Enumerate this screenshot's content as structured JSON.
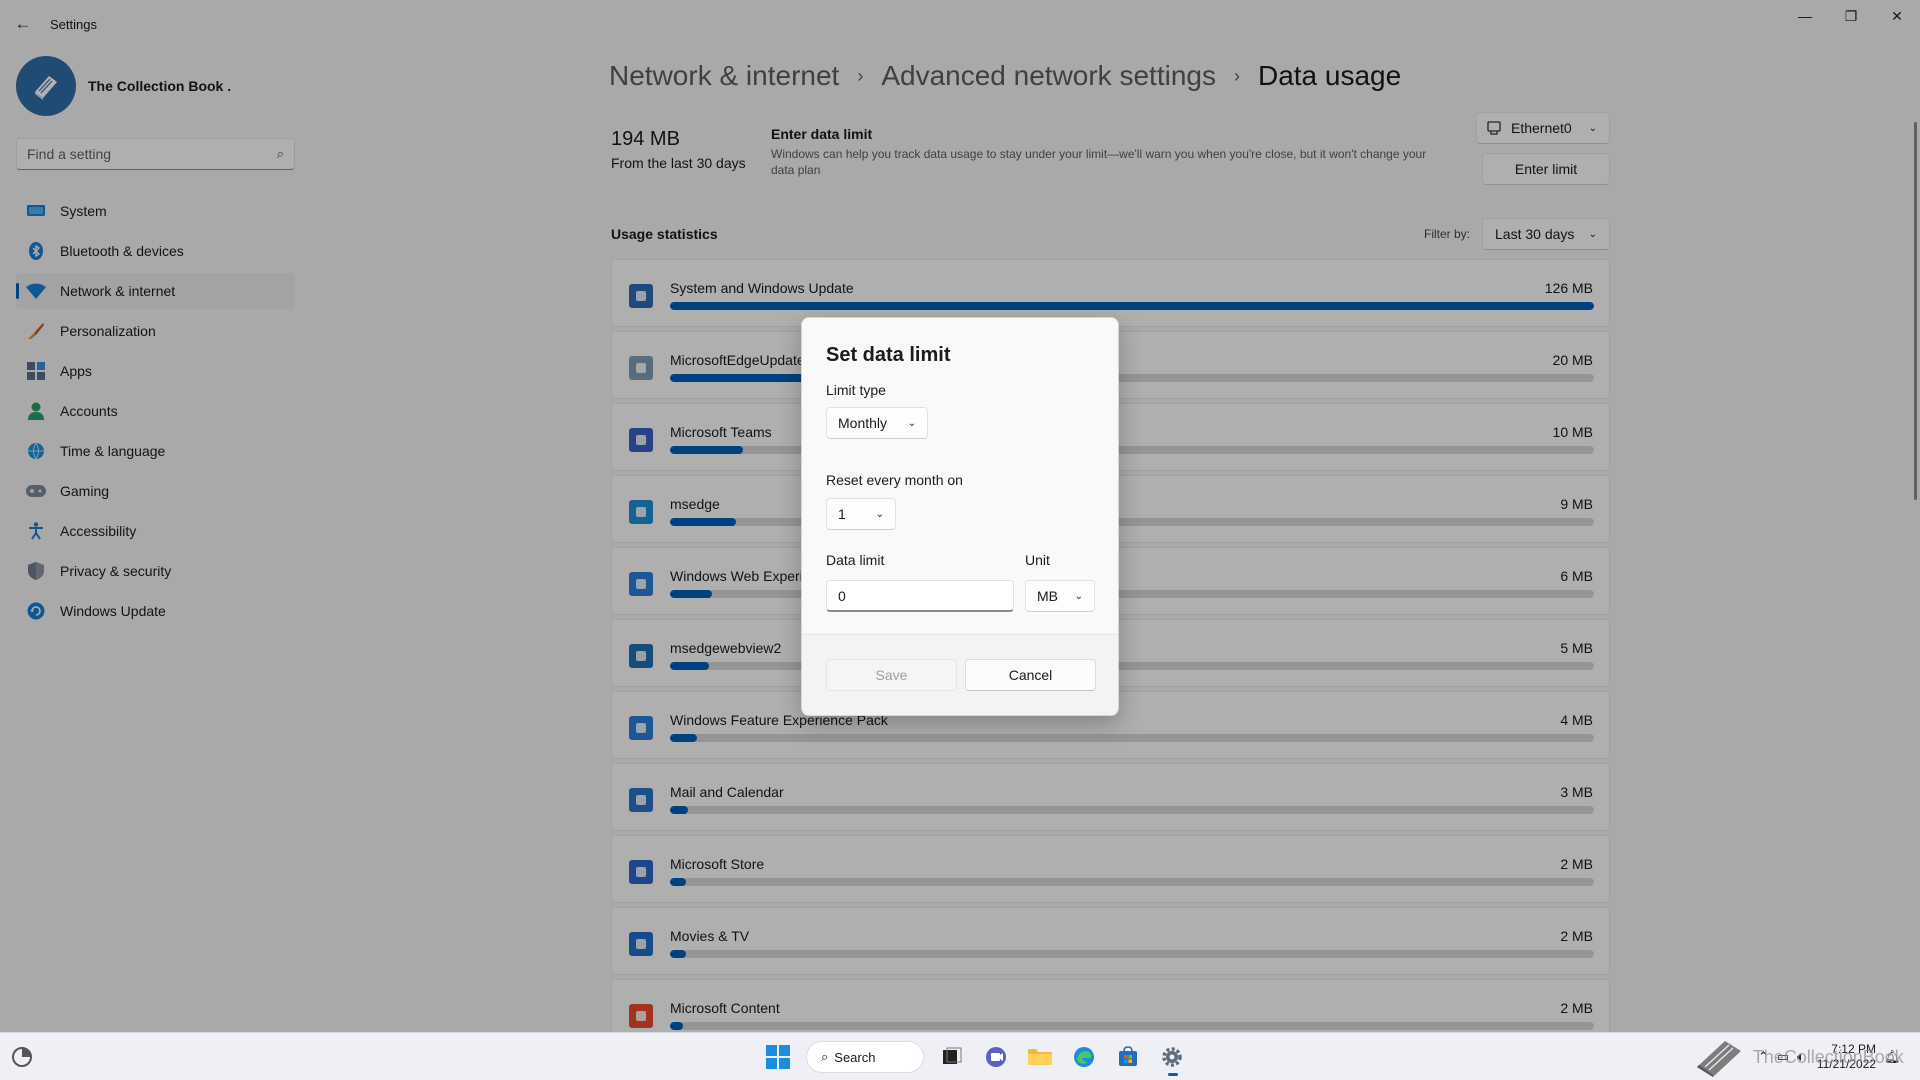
{
  "window": {
    "title": "Settings",
    "back_label": "←",
    "minimize": "—",
    "maximize": "❐",
    "close": "✕"
  },
  "profile": {
    "name": "The Collection Book ."
  },
  "search": {
    "placeholder": "Find a setting"
  },
  "nav": [
    {
      "label": "System",
      "icon": "monitor-icon"
    },
    {
      "label": "Bluetooth & devices",
      "icon": "bluetooth-icon"
    },
    {
      "label": "Network & internet",
      "icon": "wifi-icon",
      "active": true
    },
    {
      "label": "Personalization",
      "icon": "brush-icon"
    },
    {
      "label": "Apps",
      "icon": "apps-icon"
    },
    {
      "label": "Accounts",
      "icon": "person-icon"
    },
    {
      "label": "Time & language",
      "icon": "globe-clock-icon"
    },
    {
      "label": "Gaming",
      "icon": "gamepad-icon"
    },
    {
      "label": "Accessibility",
      "icon": "accessibility-icon"
    },
    {
      "label": "Privacy & security",
      "icon": "shield-icon"
    },
    {
      "label": "Windows Update",
      "icon": "update-icon"
    }
  ],
  "breadcrumb": {
    "items": [
      "Network & internet",
      "Advanced network settings"
    ],
    "separator": "›",
    "current": "Data usage"
  },
  "summary": {
    "amount": "194 MB",
    "period": "From the last 30 days",
    "limit_title": "Enter data limit",
    "limit_desc": "Windows can help you track data usage to stay under your limit—we'll warn you when you're close, but it won't change your data plan"
  },
  "adapter": {
    "value": "Ethernet0"
  },
  "enter_limit_label": "Enter limit",
  "stats": {
    "title": "Usage statistics",
    "filter_label": "Filter by:",
    "filter_value": "Last 30 days"
  },
  "usage": [
    {
      "name": "System and Windows Update",
      "amount": "126 MB",
      "fraction": 1.0,
      "icon_color": "#2b6cb0"
    },
    {
      "name": "MicrosoftEdgeUpdate",
      "amount": "20 MB",
      "fraction": 0.16,
      "icon_color": "#7f9bb5"
    },
    {
      "name": "Microsoft Teams",
      "amount": "10 MB",
      "fraction": 0.079,
      "icon_color": "#3b5fc0"
    },
    {
      "name": "msedge",
      "amount": "9 MB",
      "fraction": 0.071,
      "icon_color": "#1f8dd6"
    },
    {
      "name": "Windows Web Experience Pack",
      "amount": "6 MB",
      "fraction": 0.045,
      "icon_color": "#2a7ad6"
    },
    {
      "name": "msedgewebview2",
      "amount": "5 MB",
      "fraction": 0.042,
      "icon_color": "#1e6fa8"
    },
    {
      "name": "Windows Feature Experience Pack",
      "amount": "4 MB",
      "fraction": 0.029,
      "icon_color": "#2a7ad6"
    },
    {
      "name": "Mail and Calendar",
      "amount": "3 MB",
      "fraction": 0.02,
      "icon_color": "#2d72c8"
    },
    {
      "name": "Microsoft Store",
      "amount": "2 MB",
      "fraction": 0.017,
      "icon_color": "#2b65c6"
    },
    {
      "name": "Movies & TV",
      "amount": "2 MB",
      "fraction": 0.017,
      "icon_color": "#1f6ec4"
    },
    {
      "name": "Microsoft Content",
      "amount": "2 MB",
      "fraction": 0.014,
      "icon_color": "#e94a2c"
    }
  ],
  "dialog": {
    "title": "Set data limit",
    "limit_type_label": "Limit type",
    "limit_type_value": "Monthly",
    "reset_label": "Reset every month on",
    "reset_value": "1",
    "data_limit_label": "Data limit",
    "data_limit_value": "0",
    "unit_label": "Unit",
    "unit_value": "MB",
    "save_label": "Save",
    "cancel_label": "Cancel"
  },
  "taskbar": {
    "search_label": "Search",
    "watermark": "TheCollectionBook",
    "time": "7:12 PM",
    "date": "11/21/2022"
  },
  "colors": {
    "accent": "#005fb8",
    "overlay": "rgba(0,0,0,0.30)"
  }
}
